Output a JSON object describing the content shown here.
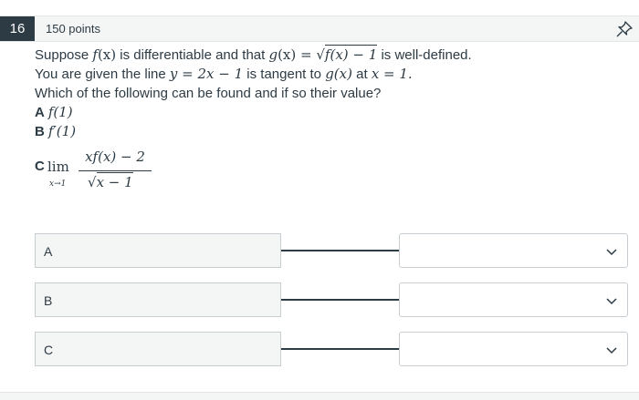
{
  "question": {
    "number": "16",
    "points": "150 points",
    "line1_pre": "Suppose ",
    "line1_f": "f",
    "line1_x": "(x)",
    "line1_mid": " is differentiable and that ",
    "line1_g": "g",
    "line1_gx": "(x) = ",
    "line1_sqrt": "f(x) − 1",
    "line1_post": " is well-defined.",
    "line2_pre": "You are given the line ",
    "line2_eq": "y = 2x − 1",
    "line2_mid": " is tangent to ",
    "line2_g": "g(x)",
    "line2_at": " at ",
    "line2_x": "x = 1.",
    "line3": "Which of the following can be found and if so their value?",
    "opt_a_label": "A",
    "opt_a_expr": "f(1)",
    "opt_b_label": "B",
    "opt_b_expr": "f′(1)",
    "opt_c_label": "C",
    "opt_c_lim": "lim",
    "opt_c_sub": "x→1",
    "opt_c_num": "xf(x) − 2",
    "opt_c_den": "x − 1"
  },
  "matching": [
    {
      "label": "A",
      "selected": ""
    },
    {
      "label": "B",
      "selected": ""
    },
    {
      "label": "C",
      "selected": ""
    }
  ],
  "icons": {
    "pin": "pin-icon",
    "dropdown": "chevron-down-icon"
  }
}
